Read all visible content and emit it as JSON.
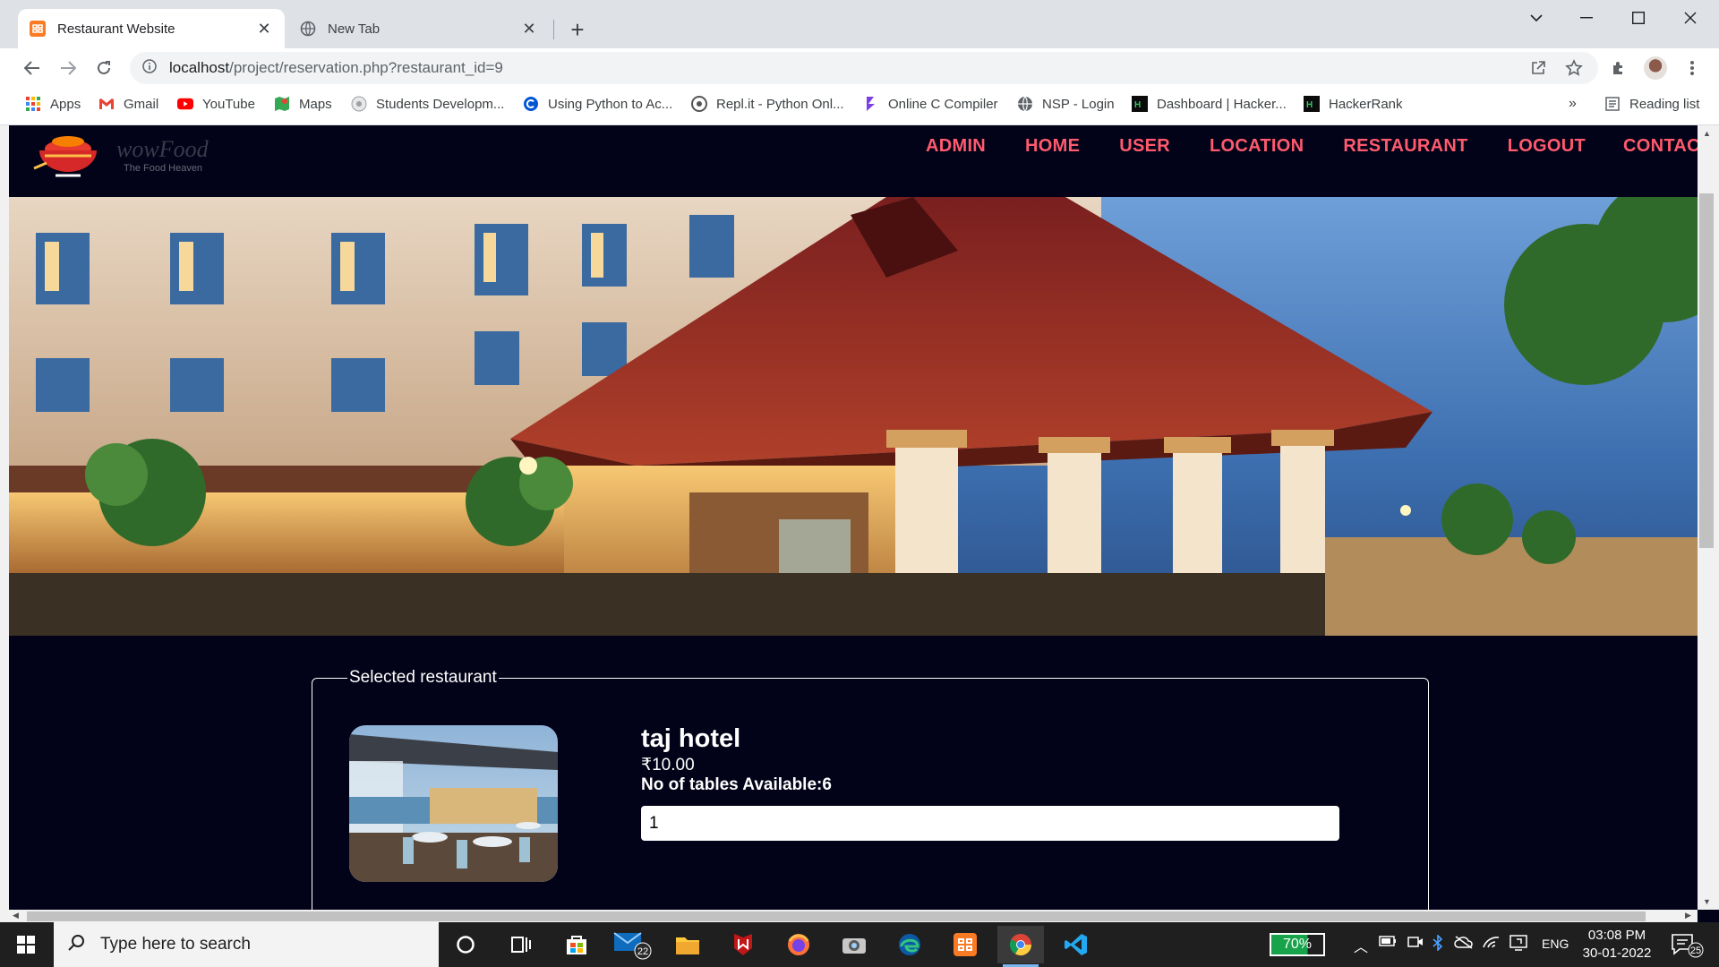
{
  "browser": {
    "tabs": [
      {
        "title": "Restaurant Website",
        "active": true,
        "icon": "xampp-icon"
      },
      {
        "title": "New Tab",
        "active": false,
        "icon": "globe-icon"
      }
    ],
    "url_host": "localhost",
    "url_path": "/project/reservation.php?restaurant_id=9",
    "bookmarks": [
      {
        "label": "Apps",
        "icon": "apps-grid-icon"
      },
      {
        "label": "Gmail",
        "icon": "gmail-icon"
      },
      {
        "label": "YouTube",
        "icon": "youtube-icon"
      },
      {
        "label": "Maps",
        "icon": "maps-icon"
      },
      {
        "label": "Students Developm...",
        "icon": "google-developers-icon"
      },
      {
        "label": "Using Python to Ac...",
        "icon": "coursera-icon"
      },
      {
        "label": "Repl.it - Python Onl...",
        "icon": "replit-icon"
      },
      {
        "label": "Online C Compiler",
        "icon": "compiler-icon"
      },
      {
        "label": "NSP - Login",
        "icon": "globe-icon"
      },
      {
        "label": "Dashboard | Hacker...",
        "icon": "hackerrank-icon"
      },
      {
        "label": "HackerRank",
        "icon": "hackerrank-icon"
      }
    ],
    "reading_list": "Reading list",
    "more_bookmarks": "»"
  },
  "site": {
    "logo_text": "wowFood",
    "logo_tagline": "The Food Heaven",
    "nav": [
      "ADMIN",
      "HOME",
      "USER",
      "LOCATION",
      "RESTAURANT",
      "LOGOUT",
      "CONTACT"
    ],
    "accent_color": "#ff5a6e",
    "background_color": "#020218"
  },
  "reservation": {
    "legend": "Selected restaurant",
    "restaurant_name": "taj hotel",
    "price": "₹10.00",
    "tables_available": "No of tables Available:6",
    "quantity_value": "1"
  },
  "taskbar": {
    "search_placeholder": "Type here to search",
    "mail_badge": "22",
    "battery": "70%",
    "language": "ENG",
    "time": "03:08 PM",
    "date": "30-01-2022",
    "notification_count": "25"
  }
}
